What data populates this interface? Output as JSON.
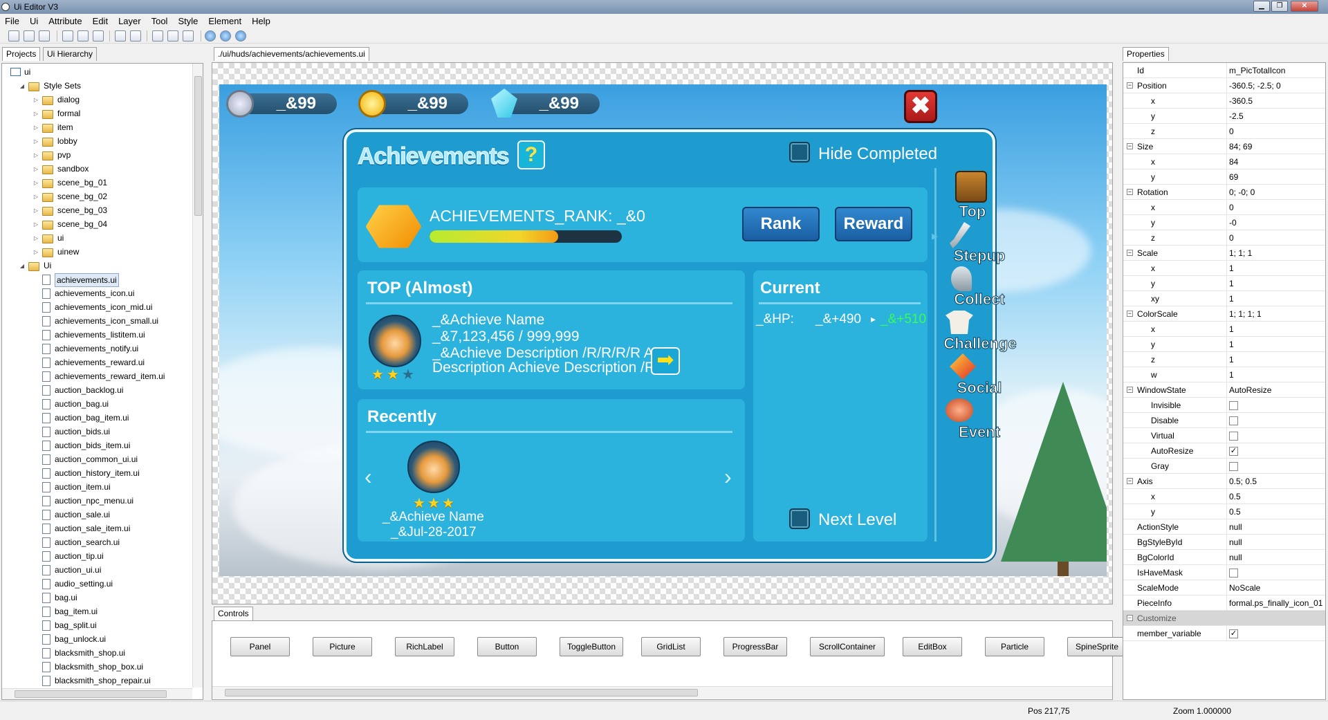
{
  "window": {
    "title": "Ui Editor V3"
  },
  "menu": [
    "File",
    "Ui",
    "Attribute",
    "Edit",
    "Layer",
    "Tool",
    "Style",
    "Element",
    "Help"
  ],
  "left_tabs": [
    "Projects",
    "Ui Hierarchy"
  ],
  "tree": {
    "root": "ui",
    "style_sets_label": "Style Sets",
    "style_sets": [
      "dialog",
      "formal",
      "item",
      "lobby",
      "pvp",
      "sandbox",
      "scene_bg_01",
      "scene_bg_02",
      "scene_bg_03",
      "scene_bg_04",
      "ui",
      "uinew"
    ],
    "ui_folder_label": "Ui",
    "files": [
      "achievements.ui",
      "achievements_icon.ui",
      "achievements_icon_mid.ui",
      "achievements_icon_small.ui",
      "achievements_listitem.ui",
      "achievements_notify.ui",
      "achievements_reward.ui",
      "achievements_reward_item.ui",
      "auction_backlog.ui",
      "auction_bag.ui",
      "auction_bag_item.ui",
      "auction_bids.ui",
      "auction_bids_item.ui",
      "auction_common_ui.ui",
      "auction_history_item.ui",
      "auction_item.ui",
      "auction_npc_menu.ui",
      "auction_sale.ui",
      "auction_sale_item.ui",
      "auction_search.ui",
      "auction_tip.ui",
      "auction_ui.ui",
      "audio_setting.ui",
      "bag.ui",
      "bag_item.ui",
      "bag_split.ui",
      "bag_unlock.ui",
      "blacksmith_shop.ui",
      "blacksmith_shop_box.ui",
      "blacksmith_shop_repair.ui"
    ],
    "selected": "achievements.ui"
  },
  "editor_tab": "./ui/huds/achievements/achievements.ui",
  "game": {
    "currencies": [
      "_&99",
      "_&99",
      "_&99"
    ],
    "title": "Achievements",
    "help_symbol": "?",
    "hide_completed": "Hide Completed",
    "rank_label": "ACHIEVEMENTS_RANK: _&0",
    "rank_progress": 0.67,
    "rank_button": "Rank",
    "reward_button": "Reward",
    "top_header": "TOP (Almost)",
    "top_name": "_&Achieve Name",
    "top_progress": "_&7,123,456 / 999,999",
    "top_desc1": "_&Achieve Description /R/R/R/R Achieve",
    "top_desc2": "Description Achieve Description /R/R/R/R",
    "top_stars": 2,
    "current_header": "Current",
    "hp_label": "_&HP:",
    "hp_value": "_&+490",
    "hp_next": "_&+510",
    "next_level": "Next Level",
    "recently_header": "Recently",
    "recent_name": "_&Achieve Name",
    "recent_date": "_&Jul-28-2017",
    "recent_stars": 3,
    "side_nav": [
      "Top",
      "Stepup",
      "Collect",
      "Challenge",
      "Social",
      "Event"
    ]
  },
  "controls_tab": "Controls",
  "controls": [
    "Panel",
    "Picture",
    "RichLabel",
    "Button",
    "ToggleButton",
    "GridList",
    "ProgressBar",
    "ScrollContainer",
    "EditBox",
    "Particle",
    "SpineSprite"
  ],
  "properties_tab": "Properties",
  "properties": [
    {
      "k": "Id",
      "v": "m_PicTotalIcon",
      "lvl": 0
    },
    {
      "k": "Position",
      "v": "-360.5; -2.5; 0",
      "lvl": 0,
      "group": true
    },
    {
      "k": "x",
      "v": "-360.5",
      "lvl": 1
    },
    {
      "k": "y",
      "v": "-2.5",
      "lvl": 1
    },
    {
      "k": "z",
      "v": "0",
      "lvl": 1
    },
    {
      "k": "Size",
      "v": "84; 69",
      "lvl": 0,
      "group": true
    },
    {
      "k": "x",
      "v": "84",
      "lvl": 1
    },
    {
      "k": "y",
      "v": "69",
      "lvl": 1
    },
    {
      "k": "Rotation",
      "v": "0; -0; 0",
      "lvl": 0,
      "group": true
    },
    {
      "k": "x",
      "v": "0",
      "lvl": 1
    },
    {
      "k": "y",
      "v": "-0",
      "lvl": 1
    },
    {
      "k": "z",
      "v": "0",
      "lvl": 1
    },
    {
      "k": "Scale",
      "v": "1; 1; 1",
      "lvl": 0,
      "group": true
    },
    {
      "k": "x",
      "v": "1",
      "lvl": 1
    },
    {
      "k": "y",
      "v": "1",
      "lvl": 1
    },
    {
      "k": "xy",
      "v": "1",
      "lvl": 1
    },
    {
      "k": "ColorScale",
      "v": "1; 1; 1; 1",
      "lvl": 0,
      "group": true
    },
    {
      "k": "x",
      "v": "1",
      "lvl": 1
    },
    {
      "k": "y",
      "v": "1",
      "lvl": 1
    },
    {
      "k": "z",
      "v": "1",
      "lvl": 1
    },
    {
      "k": "w",
      "v": "1",
      "lvl": 1
    },
    {
      "k": "WindowState",
      "v": "AutoResize",
      "lvl": 0,
      "group": true
    },
    {
      "k": "Invisible",
      "cb": false,
      "lvl": 1
    },
    {
      "k": "Disable",
      "cb": false,
      "lvl": 1
    },
    {
      "k": "Virtual",
      "cb": false,
      "lvl": 1
    },
    {
      "k": "AutoResize",
      "cb": true,
      "lvl": 1
    },
    {
      "k": "Gray",
      "cb": false,
      "lvl": 1
    },
    {
      "k": "Axis",
      "v": "0.5; 0.5",
      "lvl": 0,
      "group": true
    },
    {
      "k": "x",
      "v": "0.5",
      "lvl": 1
    },
    {
      "k": "y",
      "v": "0.5",
      "lvl": 1
    },
    {
      "k": "ActionStyle",
      "v": "null",
      "lvl": 0
    },
    {
      "k": "BgStyleById",
      "v": "null",
      "lvl": 0
    },
    {
      "k": "BgColorId",
      "v": "null",
      "lvl": 0
    },
    {
      "k": "IsHaveMask",
      "cb": false,
      "lvl": 0
    },
    {
      "k": "ScaleMode",
      "v": "NoScale",
      "lvl": 0
    },
    {
      "k": "PieceInfo",
      "v": "formal.ps_finally_icon_01",
      "lvl": 0
    },
    {
      "k": "Customize",
      "section": true,
      "lvl": 0
    },
    {
      "k": "member_variable",
      "cb": true,
      "lvl": 0
    }
  ],
  "status": {
    "pos": "Pos 217,75",
    "zoom": "Zoom 1.000000"
  }
}
